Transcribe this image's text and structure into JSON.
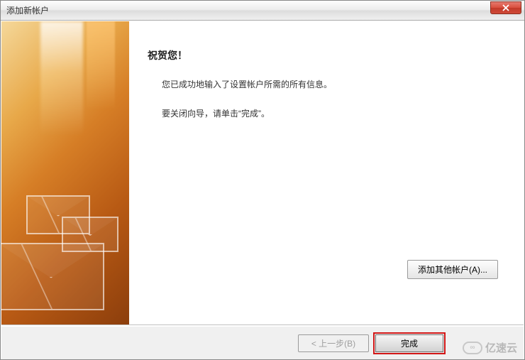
{
  "titlebar": {
    "title": "添加新帐户"
  },
  "main": {
    "heading": "祝贺您！",
    "line1": "您已成功地输入了设置帐户所需的所有信息。",
    "line2": "要关闭向导，请单击“完成”。"
  },
  "buttons": {
    "add_other": "添加其他帐户(A)...",
    "back": "< 上一步(B)",
    "finish": "完成"
  },
  "watermark": {
    "text": "亿速云",
    "icon": "∞"
  }
}
